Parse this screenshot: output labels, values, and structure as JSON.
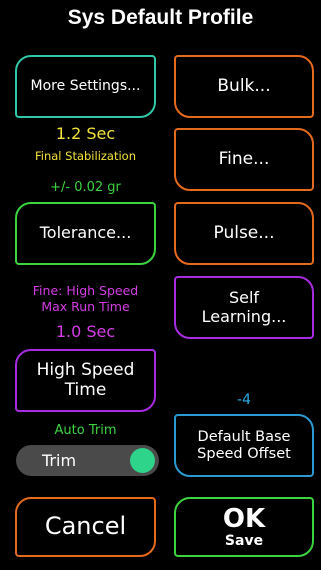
{
  "title": "Sys Default Profile",
  "buttons": {
    "more_settings": "More Settings...",
    "bulk": "Bulk...",
    "fine": "Fine...",
    "tolerance": "Tolerance...",
    "pulse": "Pulse...",
    "self_learning_1": "Self",
    "self_learning_2": "Learning...",
    "high_speed_1": "High Speed",
    "high_speed_2": "Time",
    "default_base_1": "Default Base",
    "default_base_2": "Speed Offset",
    "cancel": "Cancel",
    "ok": "OK",
    "save": "Save"
  },
  "values": {
    "stabilization_value": "1.2 Sec",
    "stabilization_label": "Final Stabilization",
    "tolerance_value": "+/- 0.02 gr",
    "fine_label_1": "Fine: High Speed",
    "fine_label_2": "Max Run Time",
    "high_speed_value": "1.0 Sec",
    "auto_trim_label": "Auto Trim",
    "offset_value": "-4"
  },
  "toggle": {
    "label": "Trim",
    "state": "on"
  },
  "colors": {
    "teal": "#2ec8a8",
    "orange": "#e46a1c",
    "green": "#3bd43f",
    "purple": "#a72ce0",
    "blue": "#2a9ad0",
    "yellow": "#f2e23a",
    "magenta": "#d63ce6",
    "knob": "#2ed48a"
  }
}
